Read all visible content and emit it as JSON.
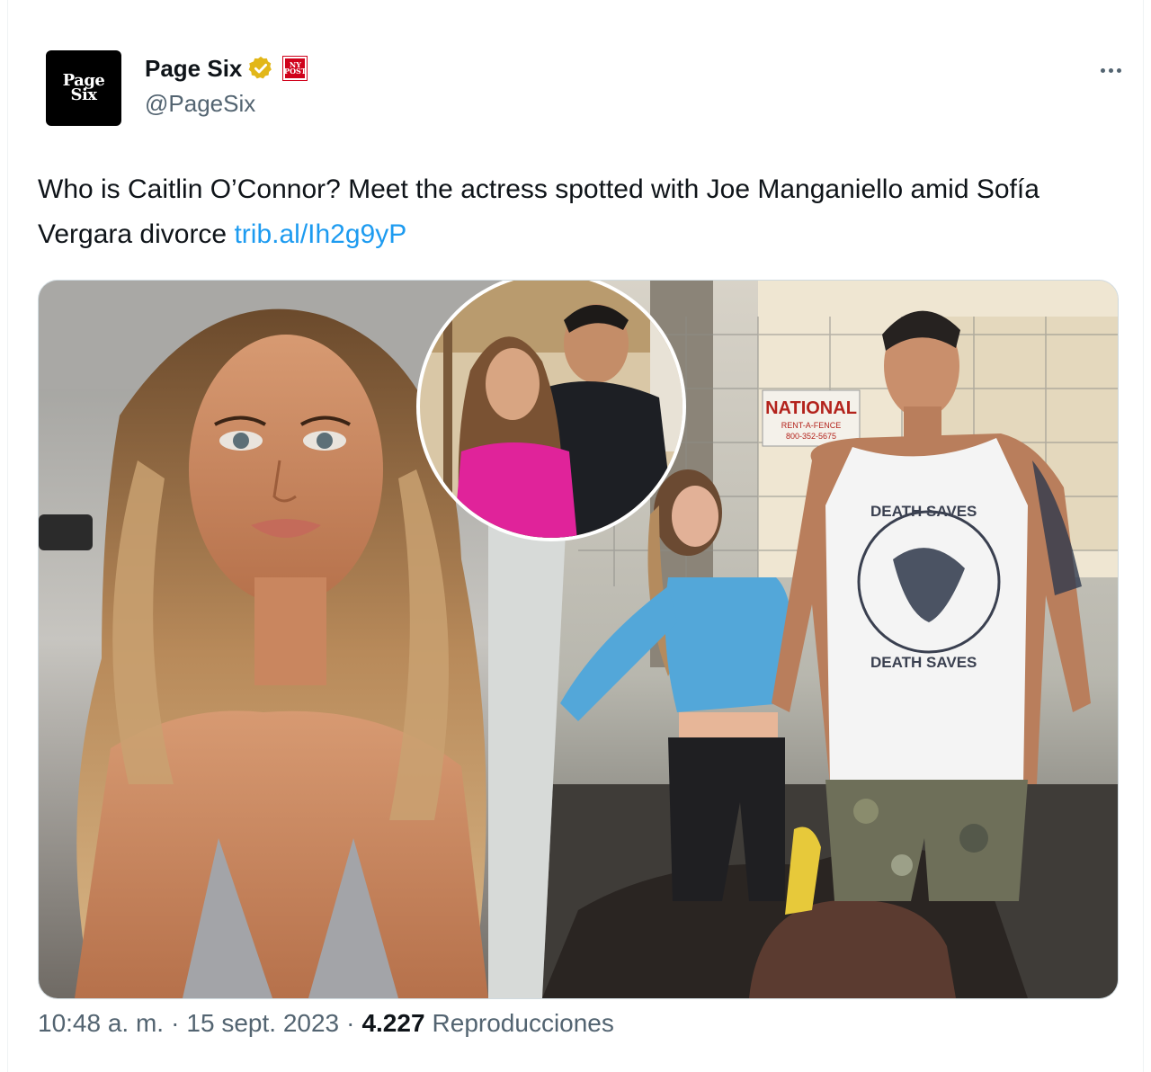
{
  "author": {
    "avatar_text_line1": "Page",
    "avatar_text_line2": "Six",
    "display_name": "Page Six",
    "handle": "@PageSix",
    "affiliate_badge_text": "NY POST",
    "verified_color": "#e2b719"
  },
  "tweet": {
    "text": "Who is Caitlin O’Connor? Meet the actress spotted with Joe Manganiello amid Sofía Vergara divorce ",
    "link_text": "trib.al/Ih2g9yP",
    "link_color": "#1d9bf0"
  },
  "media": {
    "sign_title": "NATIONAL",
    "sign_sub1": "RENT-A-FENCE",
    "sign_sub2": "800-352-5675",
    "shirt_text_top": "DEATH SAVES",
    "shirt_text_bottom": "DEATH SAVES"
  },
  "meta": {
    "time": "10:48 a. m.",
    "separator": "·",
    "date": "15 sept. 2023",
    "views_count": "4.227",
    "views_label": "Reproducciones"
  }
}
